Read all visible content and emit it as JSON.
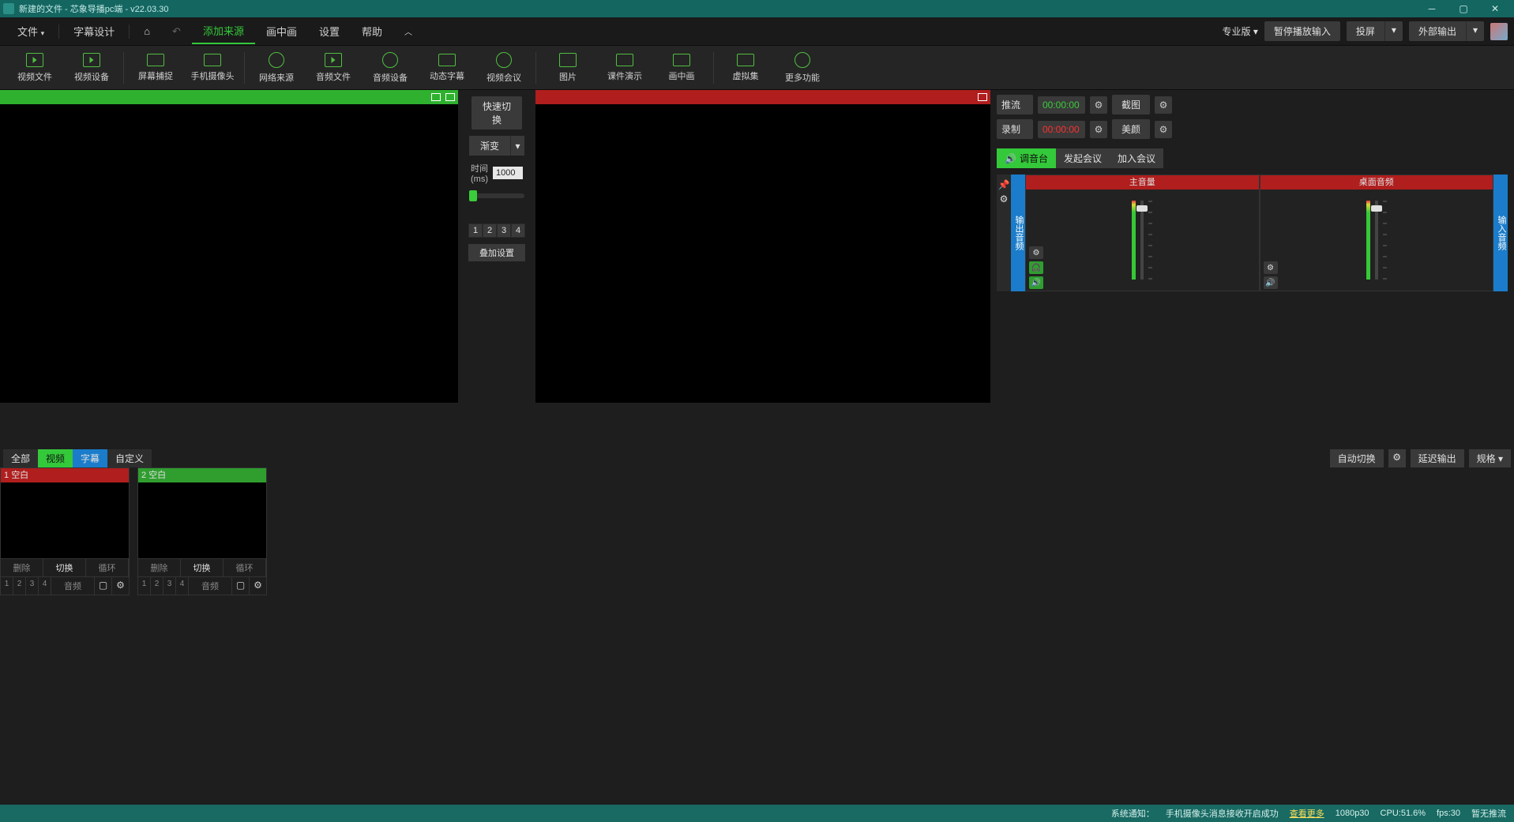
{
  "titlebar": {
    "title": "新建的文件 - 芯象导播pc端 - v22.03.30"
  },
  "menubar": {
    "items": [
      "文件",
      "字幕设计",
      "添加来源",
      "画中画",
      "设置",
      "帮助"
    ],
    "pro": "专业版",
    "pause_input": "暂停播放输入",
    "cast": "投屏",
    "external": "外部输出"
  },
  "toolbar": {
    "items": [
      {
        "label": "视频文件"
      },
      {
        "label": "视频设备"
      },
      {
        "label": "屏幕捕捉"
      },
      {
        "label": "手机摄像头"
      },
      {
        "label": "网络来源"
      },
      {
        "label": "音频文件"
      },
      {
        "label": "音频设备"
      },
      {
        "label": "动态字幕"
      },
      {
        "label": "视频会议"
      },
      {
        "label": "图片"
      },
      {
        "label": "课件演示"
      },
      {
        "label": "画中画"
      },
      {
        "label": "虚拟集"
      },
      {
        "label": "更多功能"
      }
    ]
  },
  "transition": {
    "quick_switch": "快速切换",
    "type": "渐变",
    "time_label": "时间\n(ms)",
    "time_value": "1000",
    "numbers": [
      "1",
      "2",
      "3",
      "4"
    ],
    "overlay_settings": "叠加设置"
  },
  "right_panel": {
    "stream": "推流",
    "stream_time": "00:00:00",
    "record": "录制",
    "record_time": "00:00:00",
    "screenshot": "截图",
    "beauty": "美颜",
    "tabs": {
      "mixer": "调音台",
      "create_meeting": "发起会议",
      "join_meeting": "加入会议"
    },
    "channels": {
      "main": "主音量",
      "desktop": "桌面音频"
    },
    "side_out": "输出音频",
    "side_in": "输入音频"
  },
  "scene_tabs": {
    "all": "全部",
    "video": "视频",
    "subtitle": "字幕",
    "custom": "自定义",
    "auto_switch": "自动切换",
    "delay_output": "延迟输出",
    "spec": "规格"
  },
  "scenes": [
    {
      "num": "1",
      "name": "空白",
      "state": "live"
    },
    {
      "num": "2",
      "name": "空白",
      "state": "pvw"
    }
  ],
  "scene_card": {
    "delete": "删除",
    "switch": "切换",
    "loop": "循环",
    "audio": "音频"
  },
  "statusbar": {
    "notice_label": "系统通知：",
    "notice_text": "手机摄像头消息接收开启成功",
    "more": "查看更多",
    "video_info": "1080p30",
    "cpu": "CPU:51.6%",
    "fps": "fps:30",
    "stream_status": "暂无推流"
  }
}
